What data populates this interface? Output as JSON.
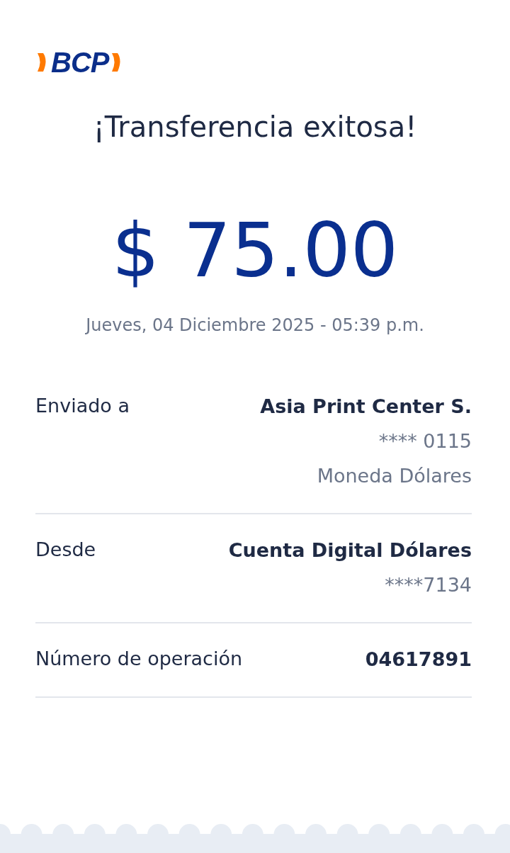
{
  "logo": {
    "text": "BCP"
  },
  "title": "¡Transferencia exitosa!",
  "amount": "$ 75.00",
  "date": "Jueves, 04 Diciembre 2025 - 05:39 p.m.",
  "details": [
    {
      "label": "Enviado a",
      "values": [
        {
          "text": "Asia Print Center S.",
          "bold": true
        },
        {
          "text": "**** 0115",
          "bold": false
        },
        {
          "text": "Moneda Dólares",
          "bold": false
        }
      ]
    },
    {
      "label": "Desde",
      "values": [
        {
          "text": "Cuenta Digital Dólares",
          "bold": true
        },
        {
          "text": "****7134",
          "bold": false
        }
      ]
    },
    {
      "label": "Número de operación",
      "values": [
        {
          "text": "04617891",
          "bold": true
        }
      ]
    }
  ]
}
